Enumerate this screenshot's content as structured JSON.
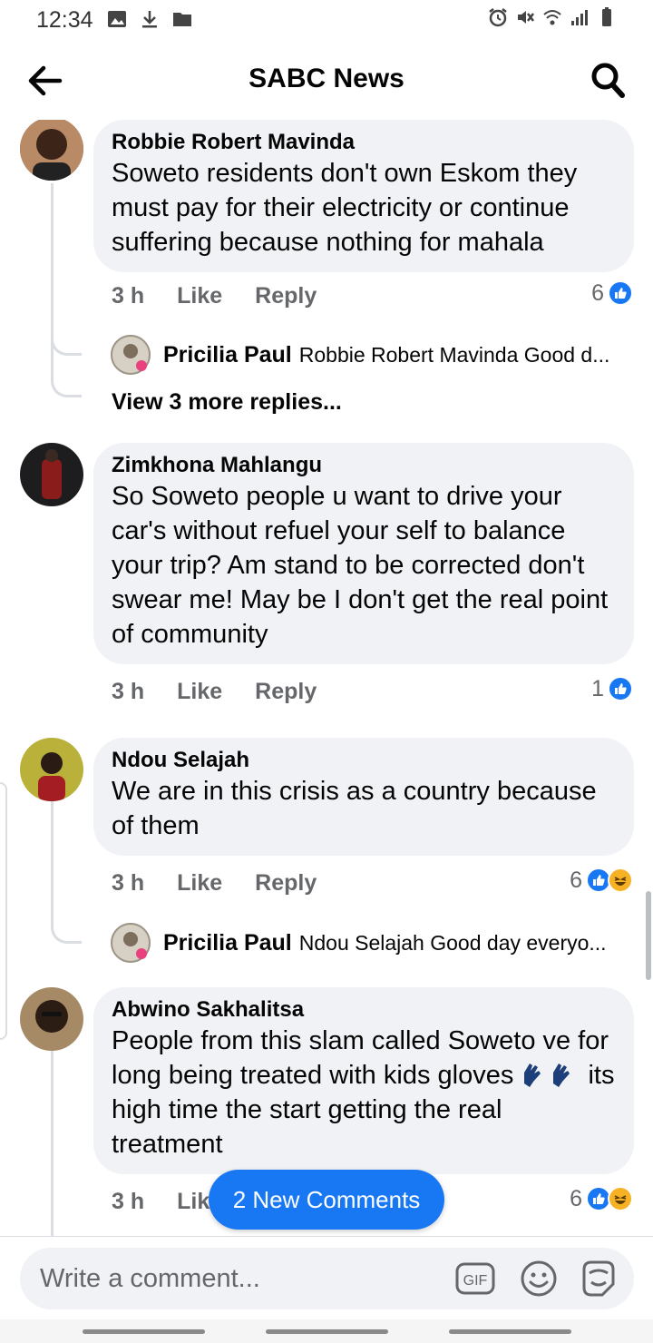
{
  "status_bar": {
    "time": "12:34",
    "left_icons": [
      "image-icon",
      "download-icon",
      "folder-icon"
    ],
    "right_icons": [
      "alarm-icon",
      "mute-icon",
      "wifi-icon",
      "signal-icon",
      "battery-icon"
    ]
  },
  "header": {
    "title": "SABC News",
    "back_icon": "arrow-left-icon",
    "search_icon": "search-icon"
  },
  "comments": [
    {
      "author": "Robbie Robert Mavinda",
      "text": "Soweto residents don't own Eskom they must pay for their electricity or continue suffering because nothing for mahala",
      "time": "3 h",
      "like_label": "Like",
      "reply_label": "Reply",
      "reaction_count": "6",
      "reactions": [
        "like"
      ],
      "reply_preview": {
        "author": "Pricilia Paul",
        "text": "Robbie Robert Mavinda Good d..."
      },
      "more_replies": "View 3 more replies..."
    },
    {
      "author": "Zimkhona Mahlangu",
      "text": "So Soweto people u want to drive your car's without refuel your self to balance your trip? Am stand to be corrected don't swear me! May be I don't get the real point of community",
      "time": "3 h",
      "like_label": "Like",
      "reply_label": "Reply",
      "reaction_count": "1",
      "reactions": [
        "like"
      ]
    },
    {
      "author": "Ndou Selajah",
      "text": "We are in this crisis as a country because of them",
      "time": "3 h",
      "like_label": "Like",
      "reply_label": "Reply",
      "reaction_count": "6",
      "reactions": [
        "like",
        "haha"
      ],
      "reply_preview": {
        "author": "Pricilia Paul",
        "text": "Ndou Selajah Good day everyo..."
      }
    },
    {
      "author": "Abwino Sakhalitsa",
      "text_before_emoji": "People from this slam called Soweto ve for long being treated with kids gloves",
      "emoji": "gloves-emoji",
      "text_after_emoji": "its high time the start getting the real treatment",
      "time": "3 h",
      "like_label": "Lik",
      "reaction_count": "6",
      "reactions": [
        "like",
        "haha"
      ]
    }
  ],
  "new_comments_button": "2 New Comments",
  "composer": {
    "placeholder": "Write a comment...",
    "icons": [
      "gif-icon",
      "smiley-icon",
      "sticker-icon"
    ]
  },
  "colors": {
    "accent": "#1877f2",
    "bubble": "#f0f2f5",
    "secondary_text": "#65676b",
    "haha": "#f7b125"
  }
}
